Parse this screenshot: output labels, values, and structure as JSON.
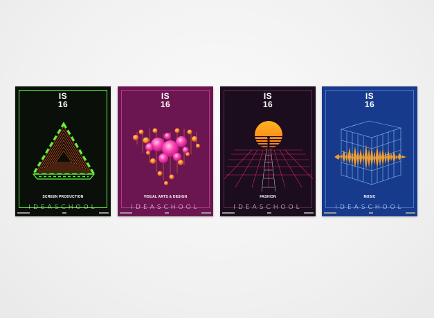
{
  "posters": [
    {
      "title_line1": "IS",
      "title_line2": "16",
      "category": "SCREEN PRODUCTION",
      "wordmark": "IDEASCHOOL",
      "background": "#0b0f0a",
      "accent": "#59ff3a",
      "secondary": "#ff5a1f"
    },
    {
      "title_line1": "IS",
      "title_line2": "16",
      "category": "VISUAL ARTS & DESIGN",
      "wordmark": "IDEASCHOOL",
      "background": "#6b1651",
      "accent": "#ff49b8",
      "secondary": "#ff8a2a"
    },
    {
      "title_line1": "IS",
      "title_line2": "16",
      "category": "FASHION",
      "wordmark": "IDEASCHOOL",
      "background": "#1b0d1e",
      "accent": "#ffa51f",
      "secondary": "#e0245e"
    },
    {
      "title_line1": "IS",
      "title_line2": "16",
      "category": "MUSIC",
      "wordmark": "IDEASCHOOL",
      "background": "#173a8c",
      "accent": "#ffa52a",
      "secondary": "#7fd3ff"
    }
  ]
}
